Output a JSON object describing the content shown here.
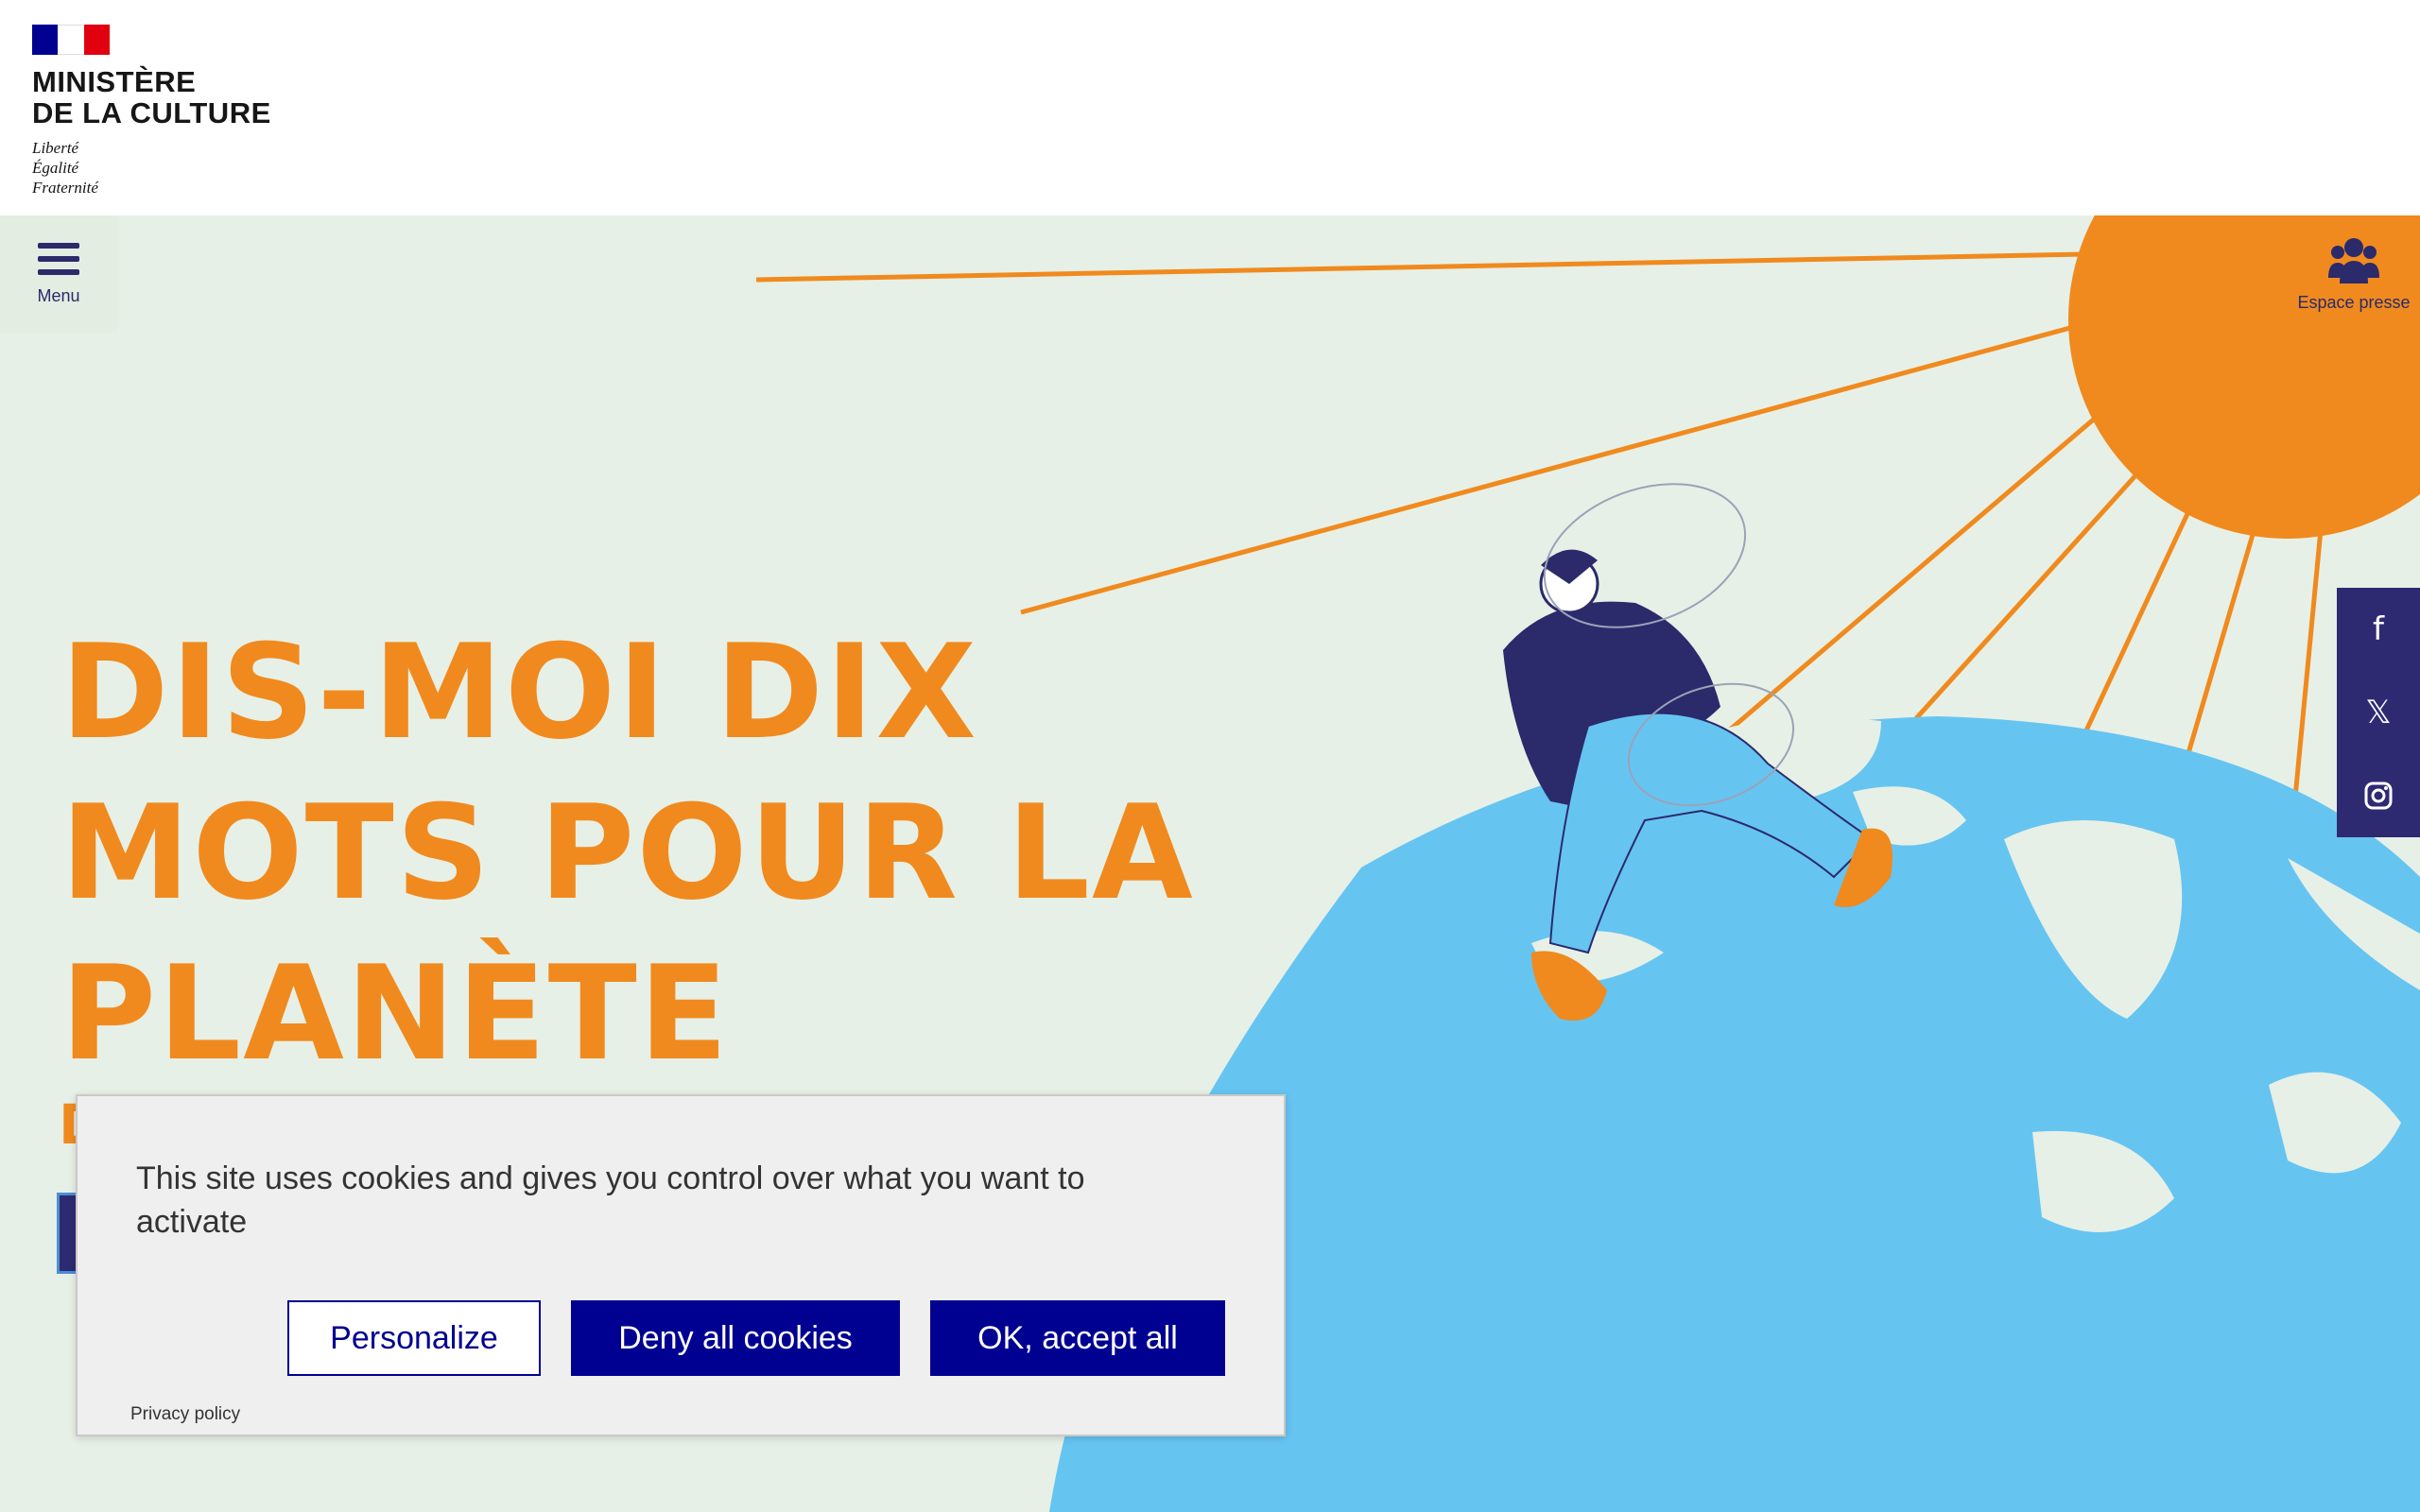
{
  "header": {
    "ministry_line1": "MINISTÈRE",
    "ministry_line2": "DE LA CULTURE",
    "motto": [
      "Liberté",
      "Égalité",
      "Fraternité"
    ]
  },
  "nav": {
    "menu_label": "Menu",
    "press_label": "Espace presse"
  },
  "hero": {
    "title_lines": [
      "DIS-MOI DIX",
      "MOTS POUR LA",
      "PLANÈTE"
    ],
    "subtitle_partial": "D"
  },
  "social": {
    "icons": [
      "facebook-icon",
      "x-icon",
      "instagram-icon"
    ]
  },
  "cookie_banner": {
    "message": "This site uses cookies and gives you control over what you want to activate",
    "personalize_label": "Personalize",
    "deny_label": "Deny all cookies",
    "accept_label": "OK, accept all",
    "privacy_label": "Privacy policy"
  },
  "colors": {
    "accent_orange": "#f08a1e",
    "navy": "#2e2a72",
    "dsfr_blue": "#000091",
    "hero_bg": "#e7f0e6",
    "globe_blue": "#66c4f1"
  }
}
